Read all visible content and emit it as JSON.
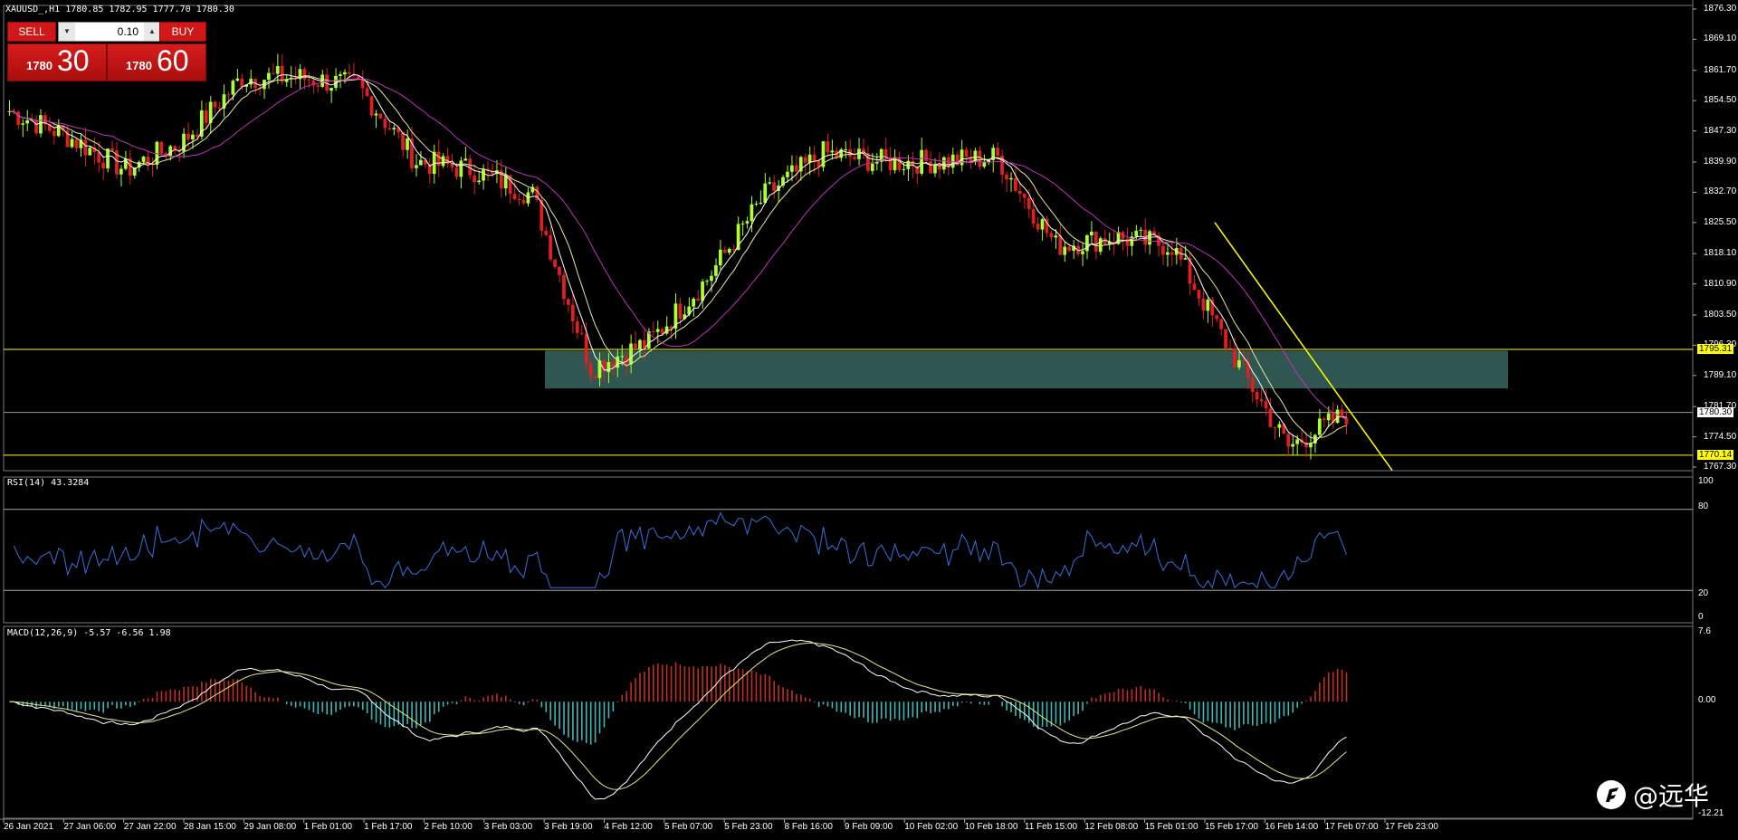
{
  "header": {
    "symbol_info": "XAUUSD_,H1  1780.85 1782.95 1777.70 1780.30"
  },
  "trade_panel": {
    "sell_label": "SELL",
    "buy_label": "BUY",
    "lot_value": "0.10",
    "sell_price_prefix": "1780",
    "sell_price_big": "30",
    "buy_price_prefix": "1780",
    "buy_price_big": "60"
  },
  "price_axis": {
    "ticks": [
      "1876.30",
      "1869.10",
      "1861.70",
      "1854.50",
      "1847.30",
      "1839.90",
      "1832.70",
      "1825.50",
      "1818.10",
      "1810.90",
      "1803.50",
      "1796.30",
      "1789.10",
      "1781.70",
      "1774.50",
      "1767.30"
    ],
    "tags": [
      {
        "text": "1795.31",
        "bg": "#ffff00",
        "fg": "#000000"
      },
      {
        "text": "1780.30",
        "bg": "#ffffff",
        "fg": "#000000"
      },
      {
        "text": "1770.14",
        "bg": "#ffff00",
        "fg": "#000000"
      }
    ]
  },
  "rsi": {
    "label": "RSI(14) 43.3284",
    "ticks": [
      "100",
      "80",
      "20",
      "0"
    ]
  },
  "macd": {
    "label": "MACD(12,26,9) -5.57 -6.56 1.98",
    "ticks": [
      "7.6",
      "0.00",
      "-12.21"
    ]
  },
  "time_axis": {
    "ticks": [
      "26 Jan 2021",
      "27 Jan 06:00",
      "27 Jan 22:00",
      "28 Jan 15:00",
      "29 Jan 08:00",
      "1 Feb 01:00",
      "1 Feb 17:00",
      "2 Feb 10:00",
      "3 Feb 03:00",
      "3 Feb 19:00",
      "4 Feb 12:00",
      "5 Feb 07:00",
      "5 Feb 23:00",
      "8 Feb 16:00",
      "9 Feb 09:00",
      "10 Feb 02:00",
      "10 Feb 18:00",
      "11 Feb 15:00",
      "12 Feb 08:00",
      "15 Feb 01:00",
      "15 Feb 17:00",
      "16 Feb 14:00",
      "17 Feb 07:00",
      "17 Feb 23:00"
    ]
  },
  "watermark": {
    "text": "@远华"
  },
  "colors": {
    "bull": "#adff2f",
    "bear": "#e02020",
    "ma_fast": "#ffffff",
    "ma_mid": "#e8e8a0",
    "ma_slow": "#c030c0",
    "zone": "#2f5650",
    "level": "#ffff00",
    "rsi": "#3a6fe0",
    "macd_pos": "#c03020",
    "macd_neg": "#40b8b8",
    "trend": "#ffff00"
  },
  "chart_data": {
    "type": "candlestick",
    "symbol": "XAUUSD_",
    "timeframe": "H1",
    "ylim": [
      1767.3,
      1876.3
    ],
    "close_path": [
      [
        "26 Jan 2021",
        1852
      ],
      [
        "27 Jan 06:00",
        1846
      ],
      [
        "27 Jan 22:00",
        1838
      ],
      [
        "28 Jan 15:00",
        1845
      ],
      [
        "29 Jan 08:00",
        1860
      ],
      [
        "1 Feb 01:00",
        1860
      ],
      [
        "1 Feb 17:00",
        1858
      ],
      [
        "2 Feb 10:00",
        1840
      ],
      [
        "3 Feb 03:00",
        1838
      ],
      [
        "3 Feb 19:00",
        1832
      ],
      [
        "4 Feb 12:00",
        1791
      ],
      [
        "5 Feb 07:00",
        1797
      ],
      [
        "5 Feb 23:00",
        1812
      ],
      [
        "8 Feb 16:00",
        1832
      ],
      [
        "9 Feb 09:00",
        1842
      ],
      [
        "10 Feb 02:00",
        1840
      ],
      [
        "10 Feb 18:00",
        1840
      ],
      [
        "11 Feb 15:00",
        1841
      ],
      [
        "12 Feb 08:00",
        1820
      ],
      [
        "15 Feb 01:00",
        1822
      ],
      [
        "15 Feb 17:00",
        1820
      ],
      [
        "16 Feb 14:00",
        1795
      ],
      [
        "17 Feb 07:00",
        1772
      ],
      [
        "17 Feb 23:00",
        1780
      ]
    ],
    "levels": [
      1795.31,
      1780.3,
      1770.14
    ],
    "zone": [
      1786,
      1795
    ],
    "rsi_range": [
      0,
      100
    ],
    "macd_range": [
      -12.21,
      7.6
    ]
  }
}
